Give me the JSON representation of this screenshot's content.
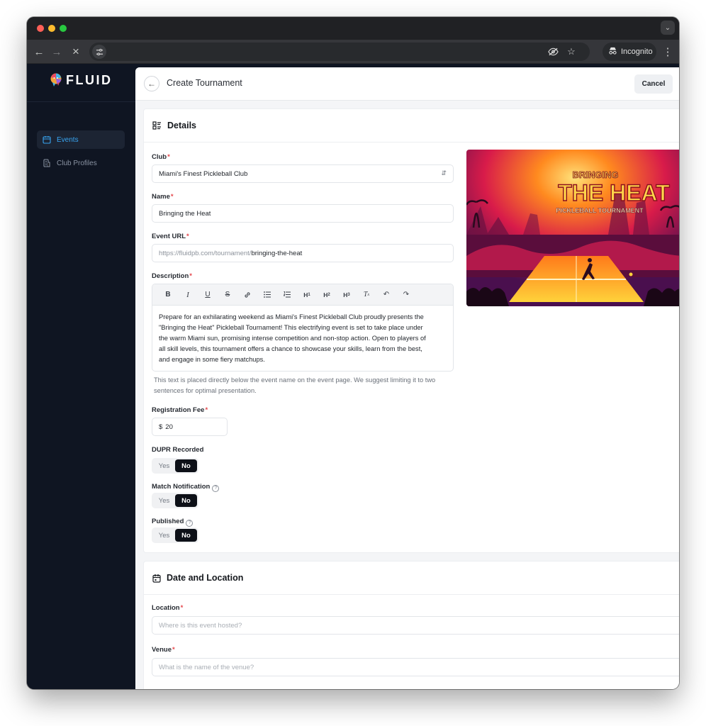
{
  "browser": {
    "incognito_label": "Incognito"
  },
  "app": {
    "logo_text": "FLUID",
    "nav": [
      {
        "label": "Events",
        "active": true
      },
      {
        "label": "Club Profiles",
        "active": false
      }
    ]
  },
  "header": {
    "title": "Create Tournament",
    "cancel_label": "Cancel"
  },
  "details": {
    "heading": "Details",
    "club": {
      "label": "Club",
      "value": "Miami's Finest Pickleball Club"
    },
    "name": {
      "label": "Name",
      "value": "Bringing the Heat"
    },
    "event_url": {
      "label": "Event URL",
      "prefix": "https://fluidpb.com/tournament/",
      "slug": "bringing-the-heat"
    },
    "description": {
      "label": "Description",
      "toolbar": [
        "B",
        "I",
        "U",
        "S",
        "link",
        "bullet-list",
        "ordered-list",
        "H1",
        "H2",
        "H3",
        "clear-format",
        "undo",
        "redo"
      ],
      "lines": [
        "Prepare for an exhilarating weekend as Miami's Finest Pickleball Club proudly presents the",
        "\"Bringing the Heat\" Pickleball Tournament! This electrifying event is set to take place under",
        "the warm Miami sun, promising intense competition and non-stop action. Open to players of",
        "all skill levels, this tournament offers a chance to showcase your skills, learn from the best,",
        "and engage in some fiery matchups."
      ],
      "helper_lines": [
        "This text is placed directly below the event name on the event page. We suggest limiting it to two",
        "sentences for optimal presentation."
      ]
    },
    "fee": {
      "label": "Registration Fee",
      "currency": "$",
      "value": "20"
    },
    "dupr": {
      "label": "DUPR Recorded",
      "yes": "Yes",
      "no": "No",
      "selected": "No"
    },
    "match_notification": {
      "label": "Match Notification",
      "yes": "Yes",
      "no": "No",
      "selected": "No"
    },
    "published": {
      "label": "Published",
      "yes": "Yes",
      "no": "No",
      "selected": "No"
    },
    "hero_image": {
      "line1": "BRINGING",
      "line2": "THE HEAT",
      "line3": "PICKLEBALL TOURNAMENT"
    }
  },
  "date_location": {
    "heading": "Date and Location",
    "location": {
      "label": "Location",
      "placeholder": "Where is this event hosted?"
    },
    "venue": {
      "label": "Venue",
      "placeholder": "What is the name of the venue?"
    }
  },
  "colors": {
    "accent": "#38a5f2",
    "sidebar_bg": "#0f1522",
    "required": "#e5484d"
  }
}
